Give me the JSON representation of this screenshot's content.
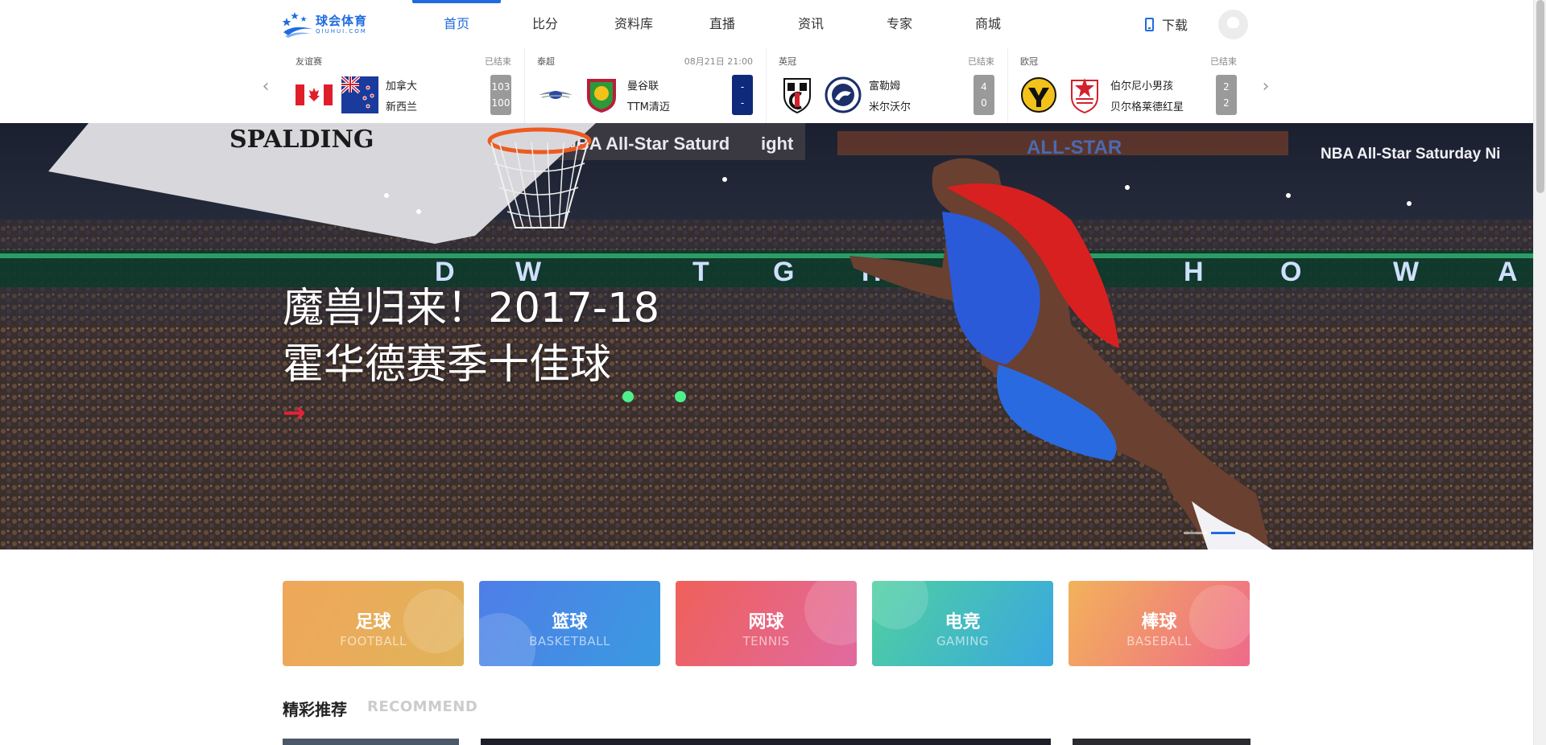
{
  "header": {
    "logo": {
      "name_cn": "球会体育",
      "name_en": "QIUHUI.COM"
    },
    "nav": [
      {
        "label": "首页",
        "active": true
      },
      {
        "label": "比分"
      },
      {
        "label": "资料库"
      },
      {
        "label": "直播"
      },
      {
        "label": "资讯"
      },
      {
        "label": "专家"
      },
      {
        "label": "商城"
      }
    ],
    "download_label": "下载",
    "accent": "#1f6ce0"
  },
  "scores": {
    "matches": [
      {
        "league": "友谊赛",
        "status": "已结束",
        "home": "加拿大",
        "away": "新西兰",
        "home_score": "103",
        "away_score": "100",
        "home_icon": "canada-flag-icon",
        "away_icon": "new-zealand-flag-icon",
        "state": "finished"
      },
      {
        "league": "泰超",
        "status": "08月21日 21:00",
        "home": "曼谷联",
        "away": "TTM清迈",
        "home_score": "-",
        "away_score": "-",
        "home_icon": "bangkok-united-crest-icon",
        "away_icon": "ttm-chiangmai-crest-icon",
        "state": "upcoming"
      },
      {
        "league": "英冠",
        "status": "已结束",
        "home": "富勒姆",
        "away": "米尔沃尔",
        "home_score": "4",
        "away_score": "0",
        "home_icon": "fulham-crest-icon",
        "away_icon": "millwall-crest-icon",
        "state": "finished"
      },
      {
        "league": "欧冠",
        "status": "已结束",
        "home": "伯尔尼小男孩",
        "away": "贝尔格莱德红星",
        "home_score": "2",
        "away_score": "2",
        "home_icon": "young-boys-crest-icon",
        "away_icon": "red-star-belgrade-crest-icon",
        "state": "finished"
      }
    ]
  },
  "banner": {
    "title_line1": "魔兽归来！2017-18",
    "title_line2": "霍华德赛季十佳球",
    "arrow": "→",
    "scene": {
      "brand": "SPALDING",
      "signs": [
        "NBA All-Star Saturd",
        "ight",
        "NBA All-Star Saturday Ni"
      ],
      "ribbon_letters": [
        "D",
        "W",
        "T",
        "G",
        "H",
        "H",
        "O",
        "W",
        "A"
      ],
      "logo": "ALL-STAR"
    },
    "slides": 2,
    "active_slide": 1
  },
  "sports": [
    {
      "cn": "足球",
      "en": "FOOTBALL"
    },
    {
      "cn": "篮球",
      "en": "BASKETBALL"
    },
    {
      "cn": "网球",
      "en": "TENNIS"
    },
    {
      "cn": "电竞",
      "en": "GAMING"
    },
    {
      "cn": "棒球",
      "en": "BASEBALL"
    }
  ],
  "recommend": {
    "title": "精彩推荐",
    "subtitle": "RECOMMEND"
  }
}
